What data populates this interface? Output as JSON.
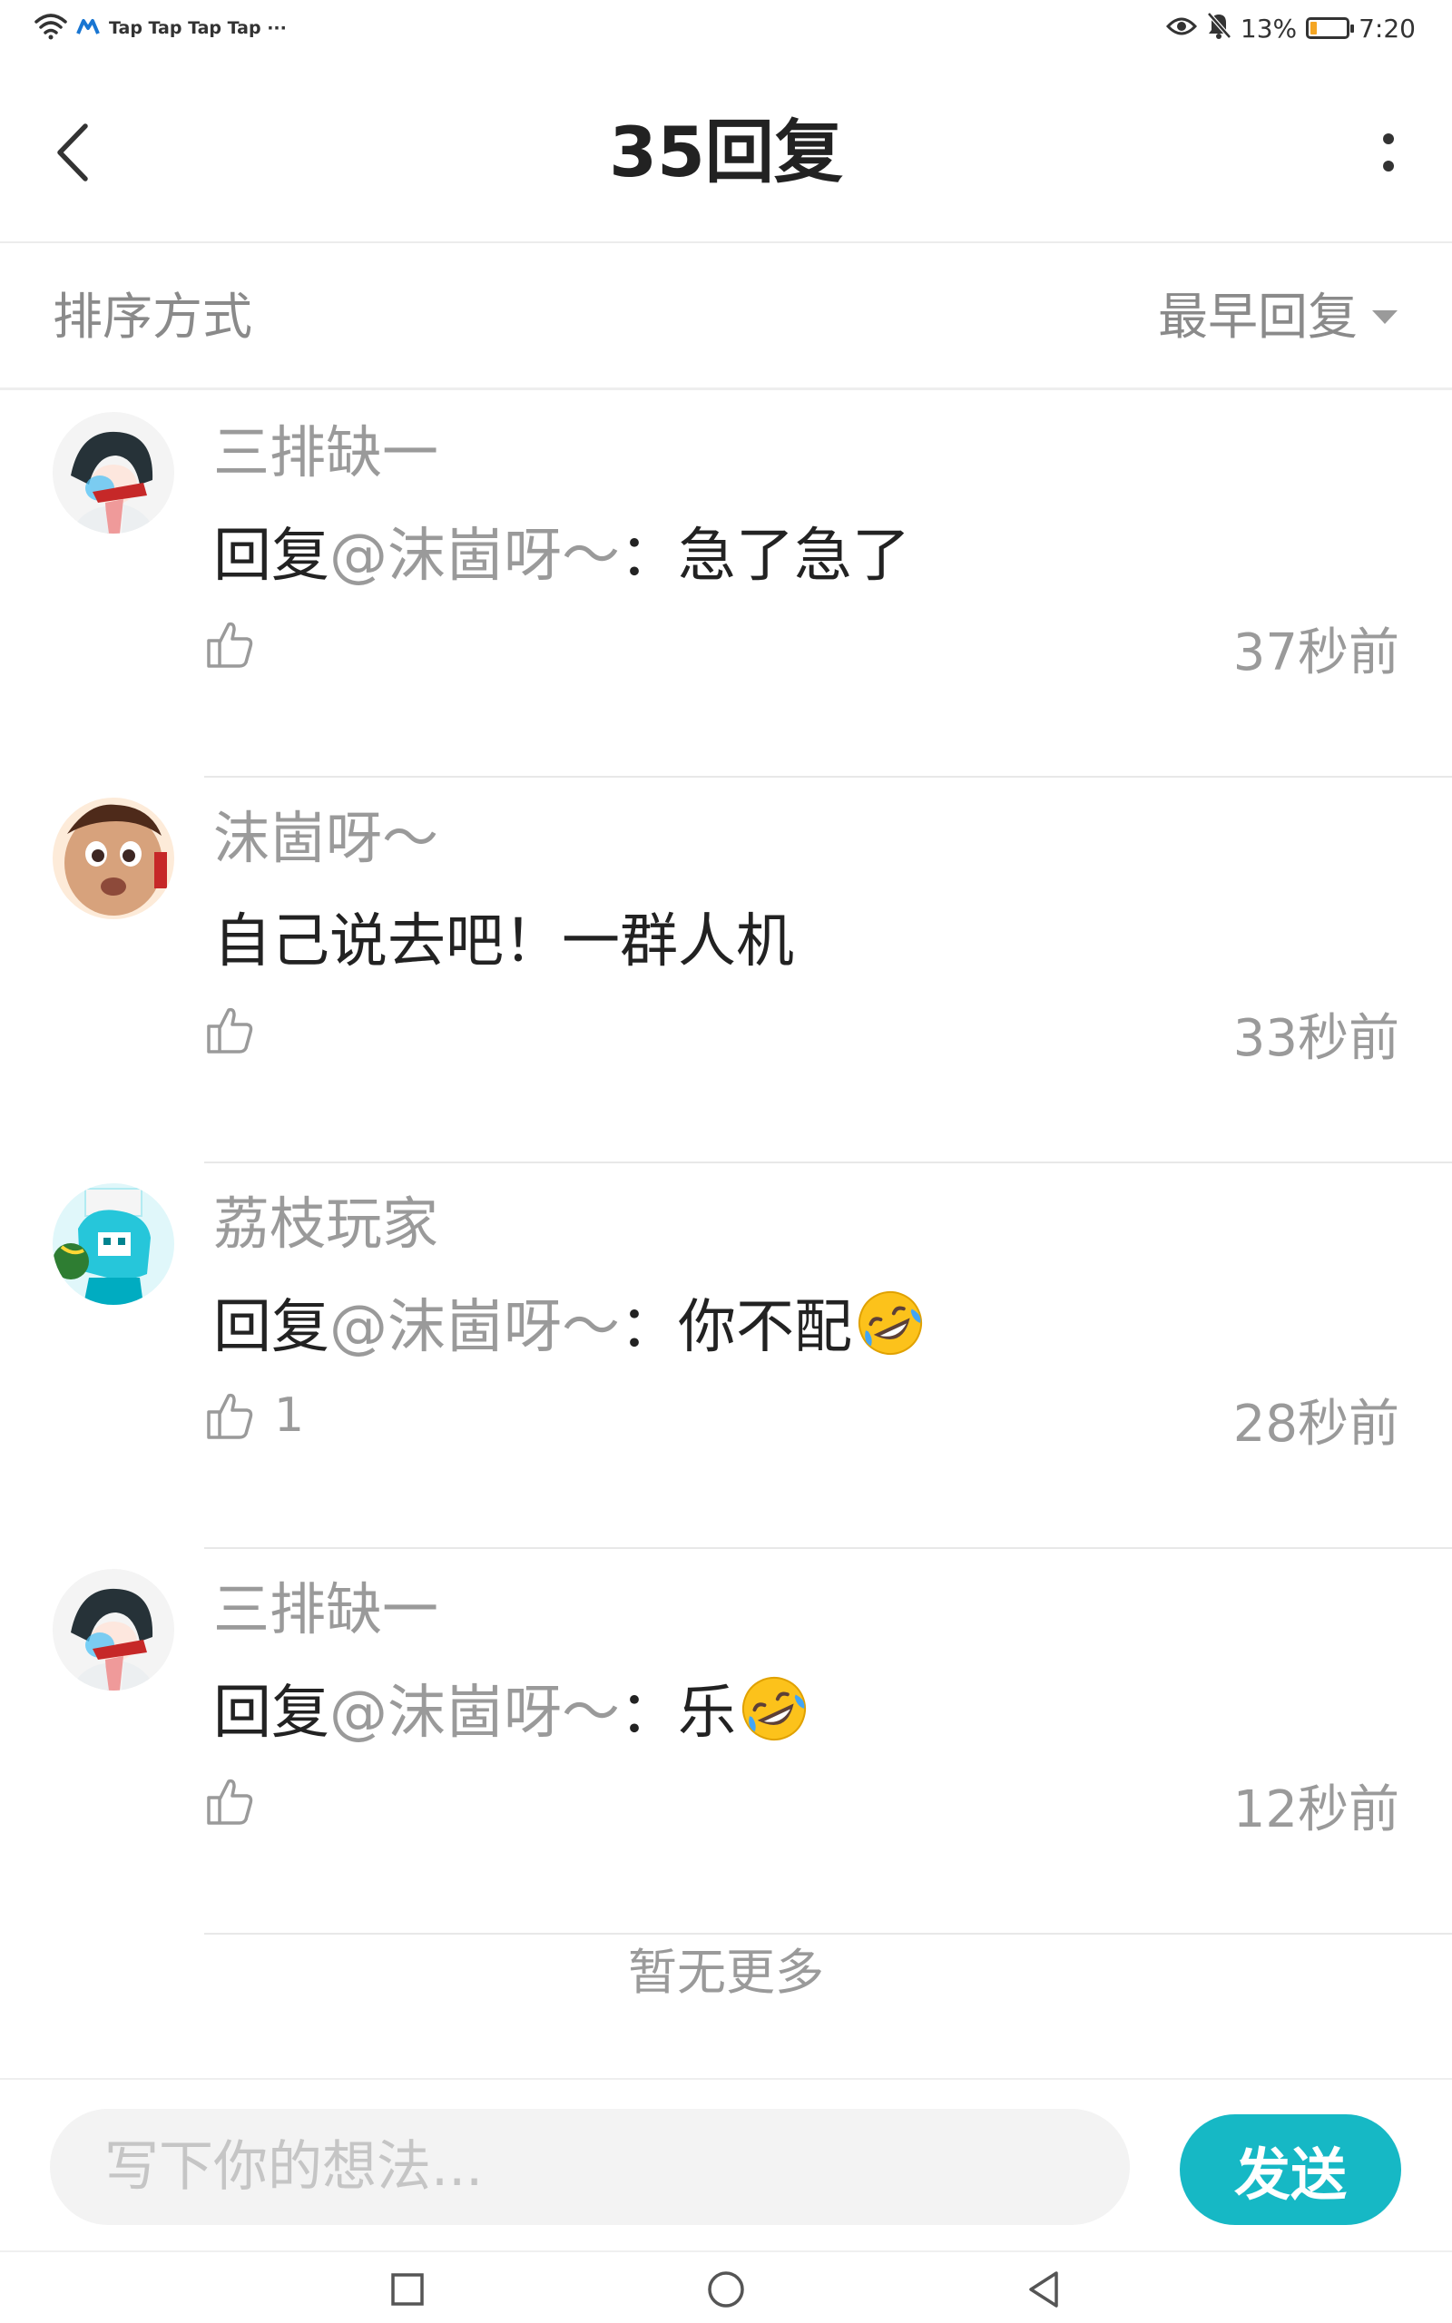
{
  "status_bar": {
    "app_indicators": "Tap Tap Tap Tap ···",
    "battery": "13%",
    "time": "7:20"
  },
  "header": {
    "title": "35回复",
    "back_icon": "back-arrow-icon",
    "more_icon": "more-vertical-icon"
  },
  "sort": {
    "label": "排序方式",
    "selected": "最早回复"
  },
  "replies": [
    {
      "user": "三排缺一",
      "prefix": "回复",
      "mention": "@沫崮呀～",
      "separator": "：",
      "text": "急了急了",
      "has_emoji": false,
      "likes": "",
      "time": "37秒前",
      "avatar_colors": [
        "#ffffff",
        "#263238",
        "#4fc3f7",
        "#c62828"
      ]
    },
    {
      "user": "沫崮呀～",
      "prefix": "",
      "mention": "",
      "separator": "",
      "text": "自己说去吧！一群人机",
      "has_emoji": false,
      "likes": "",
      "time": "33秒前",
      "avatar_colors": [
        "#d7a27c",
        "#4e2a1a",
        "#fdebd9"
      ]
    },
    {
      "user": "荔枝玩家",
      "prefix": "回复",
      "mention": "@沫崮呀～",
      "separator": "：",
      "text": "你不配",
      "has_emoji": true,
      "likes": "1",
      "time": "28秒前",
      "avatar_colors": [
        "#e0f7fa",
        "#26c6da",
        "#2e7d32"
      ]
    },
    {
      "user": "三排缺一",
      "prefix": "回复",
      "mention": "@沫崮呀～",
      "separator": "：",
      "text": "乐",
      "has_emoji": true,
      "likes": "",
      "time": "12秒前",
      "avatar_colors": [
        "#ffffff",
        "#263238",
        "#4fc3f7",
        "#c62828"
      ]
    }
  ],
  "no_more": "暂无更多",
  "composer": {
    "placeholder": "写下你的想法...",
    "send_label": "发送"
  },
  "colors": {
    "accent": "#16b8c5",
    "muted_text": "#9a9a9a",
    "primary_text": "#222222"
  }
}
